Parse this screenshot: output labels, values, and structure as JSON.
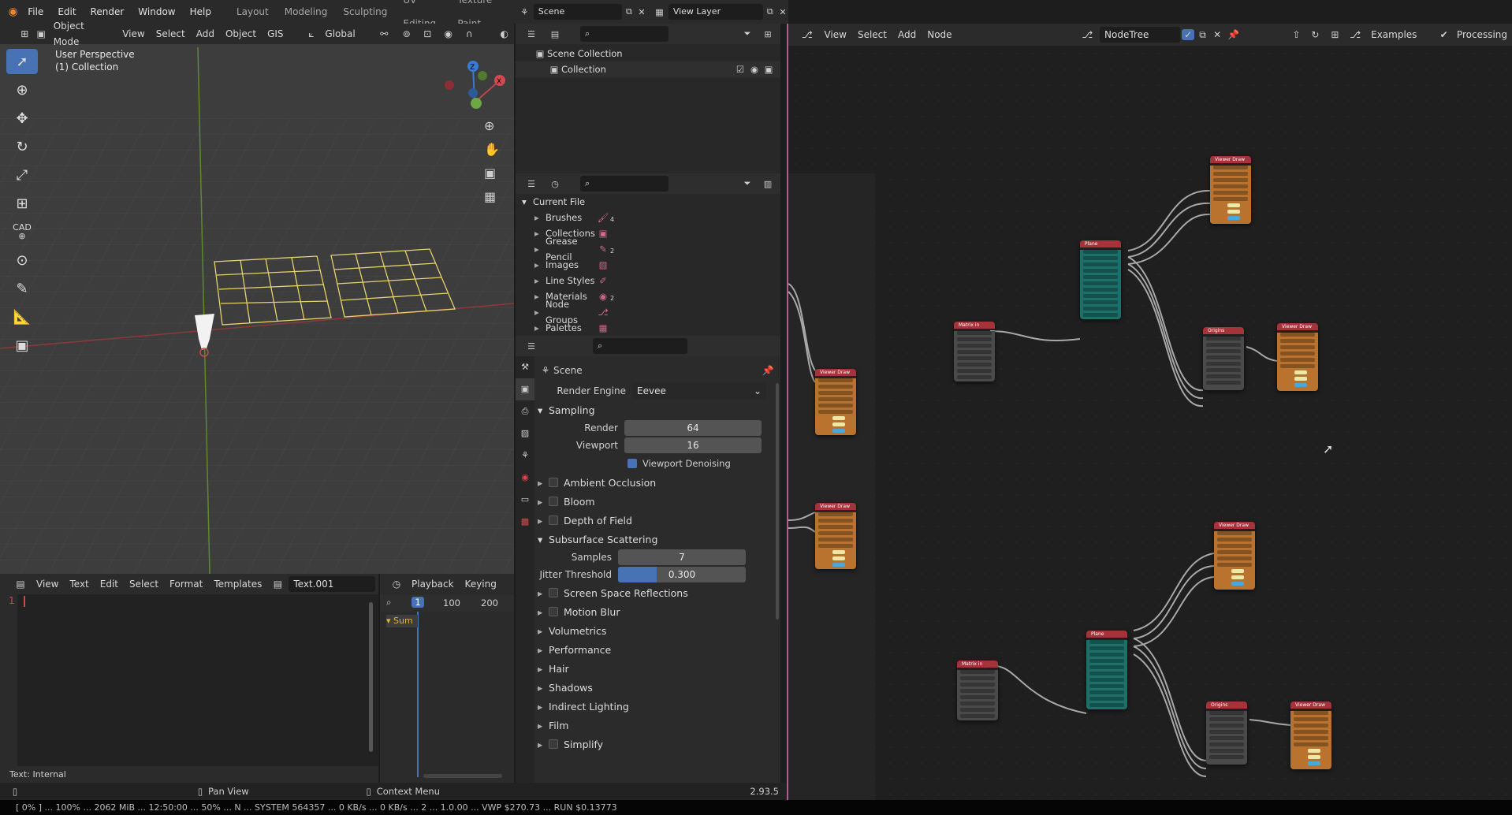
{
  "topbar": {
    "menus": [
      "File",
      "Edit",
      "Render",
      "Window",
      "Help"
    ],
    "workspaces": [
      "Layout",
      "Modeling",
      "Sculpting",
      "UV Editing",
      "Texture Paint"
    ],
    "scene": "Scene",
    "view_layer": "View Layer"
  },
  "viewport": {
    "mode": "Object Mode",
    "menus": [
      "View",
      "Select",
      "Add",
      "Object",
      "GIS"
    ],
    "orientation": "Global",
    "overlay_title": "User Perspective",
    "overlay_sub": "(1) Collection",
    "tools": [
      "select-box",
      "cursor",
      "move",
      "rotate",
      "scale",
      "transform",
      "cad",
      "annotate",
      "measure",
      "add-cube"
    ],
    "cad_label": "CAD"
  },
  "outliner": {
    "rows": [
      "Scene Collection",
      "Collection"
    ]
  },
  "datablocks": {
    "root": "Current File",
    "items": [
      {
        "label": "Brushes",
        "count": "4"
      },
      {
        "label": "Collections",
        "count": ""
      },
      {
        "label": "Grease Pencil",
        "count": "2"
      },
      {
        "label": "Images",
        "count": ""
      },
      {
        "label": "Line Styles",
        "count": ""
      },
      {
        "label": "Materials",
        "count": "2"
      },
      {
        "label": "Node Groups",
        "count": ""
      },
      {
        "label": "Palettes",
        "count": ""
      }
    ]
  },
  "properties": {
    "context": "Scene",
    "render_engine_label": "Render Engine",
    "render_engine": "Eevee",
    "sampling": "Sampling",
    "render_label": "Render",
    "render_value": "64",
    "viewport_label": "Viewport",
    "viewport_value": "16",
    "denoise": "Viewport Denoising",
    "sections_a": [
      "Ambient Occlusion",
      "Bloom",
      "Depth of Field"
    ],
    "sss": "Subsurface Scattering",
    "samples_label": "Samples",
    "samples_value": "7",
    "jitter_label": "Jitter Threshold",
    "jitter_value": "0.300",
    "jitter_fraction": 0.3,
    "sections_b": [
      {
        "label": "Screen Space Reflections",
        "check": true
      },
      {
        "label": "Motion Blur",
        "check": true
      },
      {
        "label": "Volumetrics",
        "check": false
      },
      {
        "label": "Performance",
        "check": false
      },
      {
        "label": "Hair",
        "check": false
      },
      {
        "label": "Shadows",
        "check": false
      },
      {
        "label": "Indirect Lighting",
        "check": false
      },
      {
        "label": "Film",
        "check": false
      },
      {
        "label": "Simplify",
        "check": true
      }
    ]
  },
  "text_editor": {
    "menus": [
      "View",
      "Text",
      "Edit",
      "Select",
      "Format",
      "Templates"
    ],
    "file": "Text.001",
    "line_number": "1",
    "footer": "Text: Internal"
  },
  "timeline": {
    "menus": [
      "Playback",
      "Keying"
    ],
    "current_frame": "1",
    "ticks": [
      "100",
      "200"
    ],
    "summary": "Sum"
  },
  "statusbar": {
    "left": "Pan View",
    "middle": "Context Menu",
    "version": "2.93.5"
  },
  "node_editor": {
    "menus": [
      "View",
      "Select",
      "Add",
      "Node"
    ],
    "tree_name": "NodeTree",
    "examples": "Examples",
    "processing": "Processing"
  },
  "nodes": [
    {
      "id": "vd1",
      "title": "Viewer Draw",
      "kind": "viewer"
    },
    {
      "id": "vd2",
      "title": "Viewer Draw",
      "kind": "viewer"
    },
    {
      "id": "mat1",
      "title": "Matrix in",
      "kind": "matrix"
    },
    {
      "id": "plane1",
      "title": "Plane",
      "kind": "plane"
    },
    {
      "id": "vd3",
      "title": "Viewer Draw",
      "kind": "viewer"
    },
    {
      "id": "orig1",
      "title": "Origins",
      "kind": "origins"
    },
    {
      "id": "vd4",
      "title": "Viewer Draw",
      "kind": "viewer"
    },
    {
      "id": "mat2",
      "title": "Matrix in",
      "kind": "matrix"
    },
    {
      "id": "plane2",
      "title": "Plane",
      "kind": "plane"
    },
    {
      "id": "vd5",
      "title": "Viewer Draw",
      "kind": "viewer"
    },
    {
      "id": "orig2",
      "title": "Origins",
      "kind": "origins"
    },
    {
      "id": "vd6",
      "title": "Viewer Draw",
      "kind": "viewer"
    }
  ],
  "colors": {
    "accent": "#4772b3",
    "viewer_node": "#b9732e",
    "plane_node": "#1d6f6a",
    "matrix_node": "#4a4a4a",
    "origins_node": "#4a4a4a",
    "node_header_red": "#a4333a",
    "selected_yellow": "#e6d36b"
  },
  "taskbar": {
    "text": "[ 0% ] ... 100% ... 2062 MiB ... 12:50:00 ... 50% ... N ... SYSTEM 564357 ... 0 KB/s ... 0 KB/s ... 2 ... 1.0.00 ... VWP $270.73 ... RUN $0.13773"
  }
}
